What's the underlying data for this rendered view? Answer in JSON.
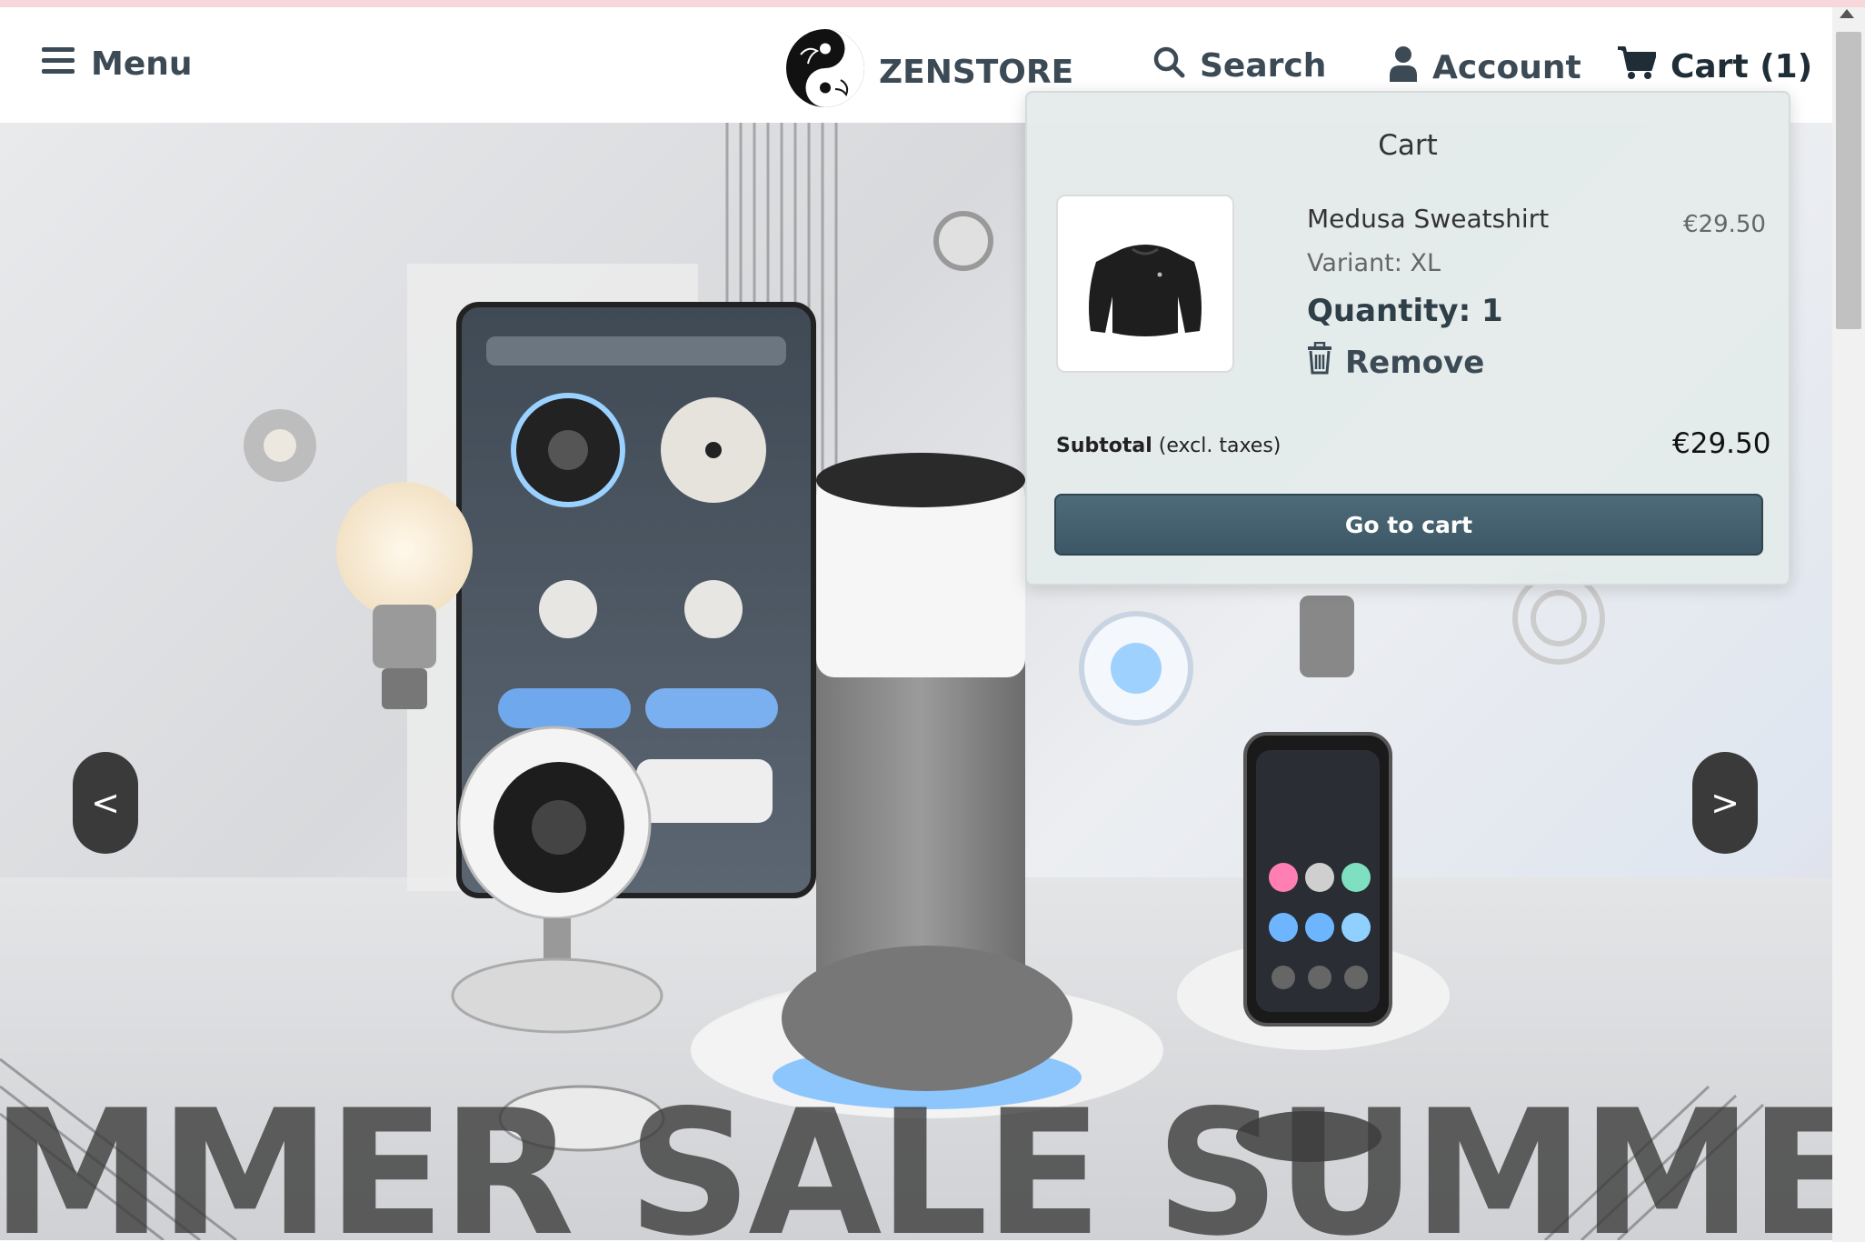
{
  "header": {
    "menu_label": "Menu",
    "brand": "ZENSTORE",
    "search_label": "Search",
    "account_label": "Account",
    "cart_label": "Cart (1)"
  },
  "hero": {
    "banner_text": "MMER SALE SUMMER SA",
    "prev_label": "<",
    "next_label": ">"
  },
  "cart_dropdown": {
    "title": "Cart",
    "item": {
      "name": "Medusa Sweatshirt",
      "variant": "Variant: XL",
      "quantity": "Quantity: 1",
      "remove_label": "Remove",
      "price": "€29.50"
    },
    "subtotal_label": "Subtotal",
    "subtotal_note": "(excl. taxes)",
    "subtotal_value": "€29.50",
    "go_to_cart_label": "Go to cart"
  },
  "icons": {
    "menu": "hamburger-icon",
    "logo": "yin-yang-logo-icon",
    "search": "search-icon",
    "account": "user-icon",
    "cart": "cart-icon",
    "remove": "trash-icon"
  },
  "colors": {
    "nav_text": "#3b4a55",
    "primary_button": "#4e6b7a",
    "dropdown_bg": "#e4ebea"
  }
}
